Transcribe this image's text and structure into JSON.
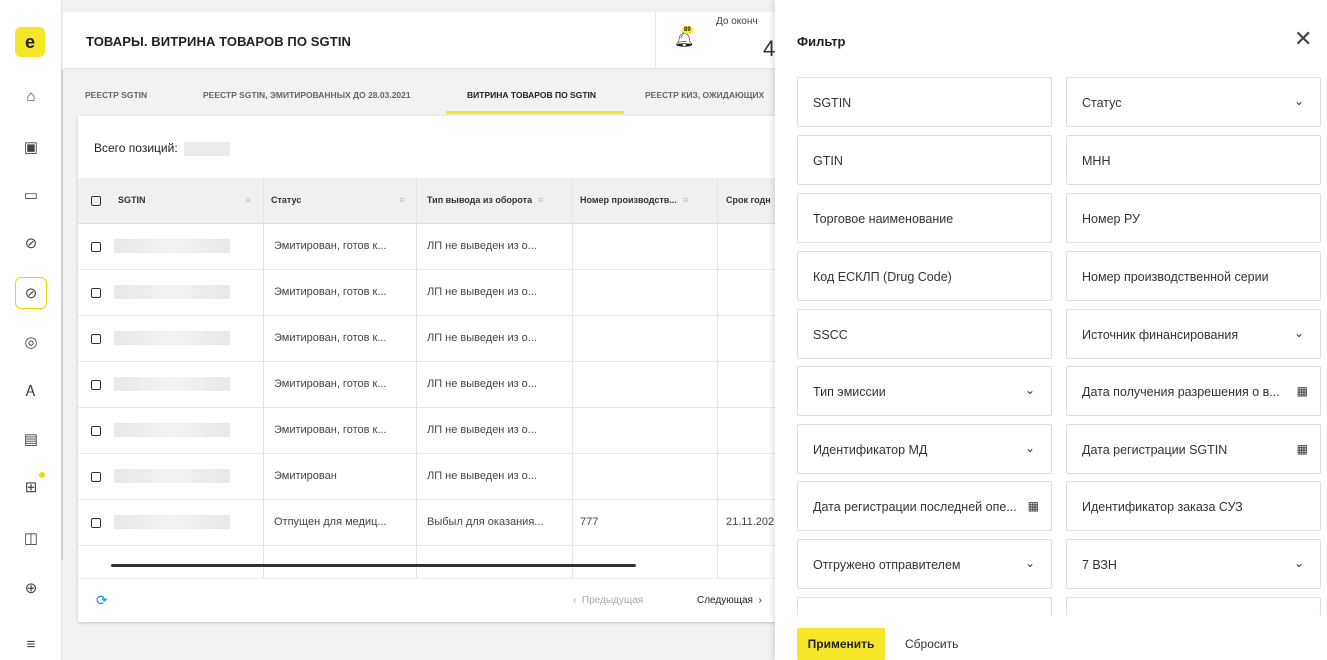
{
  "sidebar": {
    "logo": "e",
    "items": [
      {
        "icon": "home-icon",
        "glyph": "⌂"
      },
      {
        "icon": "briefcase-icon",
        "glyph": "▣"
      },
      {
        "icon": "wallet-icon",
        "glyph": "▭"
      },
      {
        "icon": "pill-icon",
        "glyph": "⊘"
      },
      {
        "icon": "link-icon",
        "glyph": "⊘"
      },
      {
        "icon": "spiral-icon",
        "glyph": "◎"
      },
      {
        "icon": "user-icon",
        "glyph": "Ꭺ"
      },
      {
        "icon": "document-icon",
        "glyph": "▤"
      },
      {
        "icon": "grid-icon",
        "glyph": "⊞"
      },
      {
        "icon": "chart-icon",
        "glyph": "◫"
      },
      {
        "icon": "globe-icon",
        "glyph": "⊕"
      },
      {
        "icon": "menu-icon",
        "glyph": "≡"
      }
    ]
  },
  "header": {
    "title": "ТОВАРЫ. ВИТРИНА ТОВАРОВ ПО SGTIN",
    "notifications_badge": "89",
    "until_label": "До оконч",
    "until_value": "4"
  },
  "tabs": [
    {
      "label": "РЕЕСТР SGTIN"
    },
    {
      "label": "РЕЕСТР SGTIN, ЭМИТИРОВАННЫХ ДО 28.03.2021"
    },
    {
      "label": "ВИТРИНА ТОВАРОВ ПО SGTIN"
    },
    {
      "label": "РЕЕСТР КИЗ, ОЖИДАЮЩИХ"
    }
  ],
  "table": {
    "total_label": "Всего позиций:",
    "columns": [
      "SGTIN",
      "Статус",
      "Тип вывода из оборота",
      "Номер производств...",
      "Срок годн"
    ],
    "rows": [
      {
        "status": "Эмитирован, готов к...",
        "out_type": "ЛП не выведен из о...",
        "batch": "",
        "expiry": ""
      },
      {
        "status": "Эмитирован, готов к...",
        "out_type": "ЛП не выведен из о...",
        "batch": "",
        "expiry": ""
      },
      {
        "status": "Эмитирован, готов к...",
        "out_type": "ЛП не выведен из о...",
        "batch": "",
        "expiry": ""
      },
      {
        "status": "Эмитирован, готов к...",
        "out_type": "ЛП не выведен из о...",
        "batch": "",
        "expiry": ""
      },
      {
        "status": "Эмитирован, готов к...",
        "out_type": "ЛП не выведен из о...",
        "batch": "",
        "expiry": ""
      },
      {
        "status": "Эмитирован",
        "out_type": "ЛП не выведен из о...",
        "batch": "",
        "expiry": ""
      },
      {
        "status": "Отпущен для медиц...",
        "out_type": "Выбыл для оказания...",
        "batch": "777",
        "expiry": "21.11.202"
      }
    ],
    "prev_label": "Предыдущая",
    "next_label": "Следующая"
  },
  "filter": {
    "title": "Фильтр",
    "fields_left": [
      {
        "label": "SGTIN",
        "kind": "text"
      },
      {
        "label": "GTIN",
        "kind": "text"
      },
      {
        "label": "Торговое наименование",
        "kind": "text"
      },
      {
        "label": "Код ЕСКЛП (Drug Code)",
        "kind": "text"
      },
      {
        "label": "SSCC",
        "kind": "text"
      },
      {
        "label": "Тип эмиссии",
        "kind": "select"
      },
      {
        "label": "Идентификатор МД",
        "kind": "select"
      },
      {
        "label": "Дата регистрации последней опе...",
        "kind": "date"
      },
      {
        "label": "Отгружено отправителем",
        "kind": "select"
      }
    ],
    "fields_right": [
      {
        "label": "Статус",
        "kind": "select"
      },
      {
        "label": "МНН",
        "kind": "text"
      },
      {
        "label": "Номер РУ",
        "kind": "text"
      },
      {
        "label": "Номер производственной серии",
        "kind": "text"
      },
      {
        "label": "Источник финансирования",
        "kind": "select"
      },
      {
        "label": "Дата получения разрешения о в...",
        "kind": "date"
      },
      {
        "label": "Дата регистрации SGTIN",
        "kind": "date"
      },
      {
        "label": "Идентификатор заказа СУЗ",
        "kind": "text"
      },
      {
        "label": "7 ВЗН",
        "kind": "select"
      }
    ],
    "apply_label": "Применить",
    "reset_label": "Сбросить"
  }
}
